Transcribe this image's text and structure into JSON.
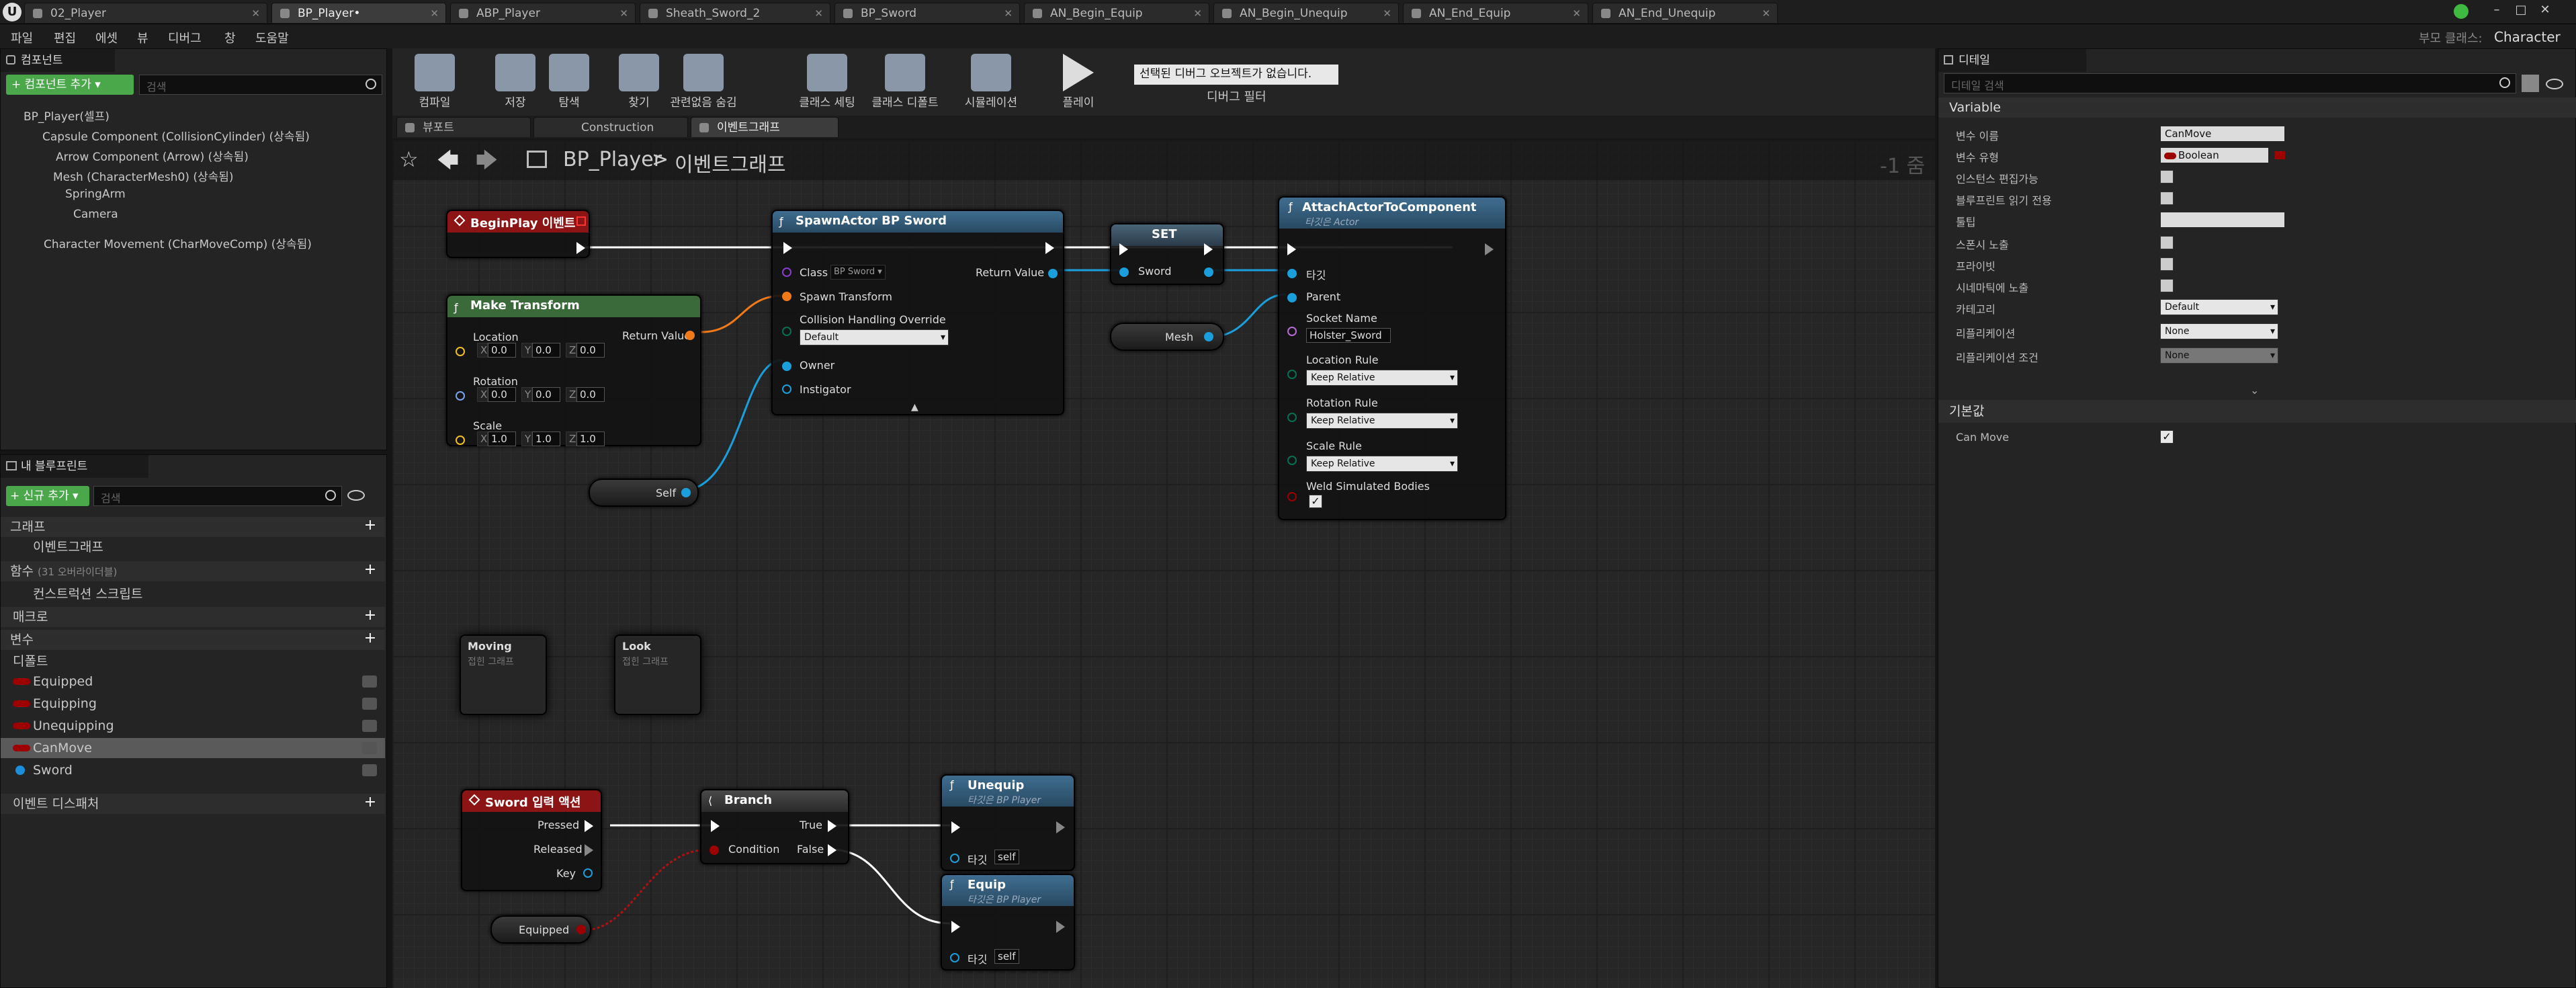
{
  "tabs": [
    {
      "label": "02_Player",
      "icon": "level-icon",
      "active": false
    },
    {
      "label": "BP_Player•",
      "icon": "blueprint-icon",
      "active": true
    },
    {
      "label": "ABP_Player",
      "icon": "anim-blueprint-icon",
      "active": false
    },
    {
      "label": "Sheath_Sword_2",
      "icon": "montage-icon",
      "active": false
    },
    {
      "label": "BP_Sword",
      "icon": "blueprint-icon",
      "active": false
    },
    {
      "label": "AN_Begin_Equip",
      "icon": "blueprint-icon",
      "active": false
    },
    {
      "label": "AN_Begin_Unequip",
      "icon": "blueprint-icon",
      "active": false
    },
    {
      "label": "AN_End_Equip",
      "icon": "blueprint-icon",
      "active": false
    },
    {
      "label": "AN_End_Unequip",
      "icon": "blueprint-icon",
      "active": false
    }
  ],
  "window": {
    "parent_class": "부모 클래스:",
    "class_name": "Character"
  },
  "menu": [
    "파일",
    "편집",
    "에셋",
    "뷰",
    "디버그",
    "창",
    "도움말"
  ],
  "components_panel": {
    "title": "컴포넌트",
    "add_button": "+ 컴포넌트 추가 ▾",
    "search_placeholder": "검색",
    "root": "BP_Player(셀프)",
    "items": [
      "Capsule Component (CollisionCylinder) (상속됨)",
      "Arrow Component (Arrow) (상속됨)",
      "Mesh (CharacterMesh0) (상속됨)",
      "SpringArm",
      "Camera",
      "Character Movement (CharMoveComp) (상속됨)"
    ]
  },
  "toolbar": {
    "buttons": [
      "컴파일",
      "저장",
      "탐색",
      "찾기",
      "관련없음 숨김",
      "클래스 세팅",
      "클래스 디폴트",
      "시뮬레이션",
      "플레이"
    ],
    "debug_dropdown": "선택된 디버그 오브젝트가 없습니다.",
    "debug_filter": "디버그 필터"
  },
  "editor_tabs": [
    "뷰포트",
    "Construction Script",
    "이벤트그래프"
  ],
  "breadcrumb": {
    "root": "BP_Player",
    "current": "이벤트그래프",
    "zoom": "-1 줌"
  },
  "my_blueprint": {
    "title": "내 블루프린트",
    "add_button": "+ 신규 추가 ▾",
    "search_placeholder": "검색",
    "graph_section": "그래프",
    "event_graph": "이벤트그래프",
    "functions_section": "함수",
    "functions_overridable": "(31 오버라이더블)",
    "construction_script": "컨스트럭션 스크립트",
    "macros_section": "매크로",
    "variables_section": "변수",
    "default_category": "디폴트",
    "variables": [
      {
        "name": "Equipped",
        "color": "#9c0000"
      },
      {
        "name": "Equipping",
        "color": "#9c0000"
      },
      {
        "name": "Unequipping",
        "color": "#9c0000"
      },
      {
        "name": "CanMove",
        "color": "#9c0000",
        "selected": true
      },
      {
        "name": "Sword",
        "color": "#1b8fdc"
      }
    ],
    "dispatchers_section": "이벤트 디스패처"
  },
  "details": {
    "title": "디테일",
    "search_placeholder": "디테일 검색",
    "variable_section": "Variable",
    "rows": [
      {
        "label": "변수 이름",
        "value": "CanMove",
        "kind": "text"
      },
      {
        "label": "변수 유형",
        "value": "Boolean",
        "kind": "type"
      },
      {
        "label": "인스턴스 편집가능",
        "value": "",
        "kind": "check"
      },
      {
        "label": "블루프린트 읽기 전용",
        "value": "",
        "kind": "check"
      },
      {
        "label": "툴팁",
        "value": "",
        "kind": "text"
      },
      {
        "label": "스폰시 노출",
        "value": "",
        "kind": "check"
      },
      {
        "label": "프라이빗",
        "value": "",
        "kind": "check"
      },
      {
        "label": "시네마틱에 노출",
        "value": "",
        "kind": "check"
      },
      {
        "label": "카테고리",
        "value": "Default",
        "kind": "dropdown"
      },
      {
        "label": "리플리케이션",
        "value": "None",
        "kind": "dropdown"
      },
      {
        "label": "리플리케이션 조건",
        "value": "None",
        "kind": "dropdown"
      }
    ],
    "default_section": "기본값",
    "default_row": {
      "label": "Can Move",
      "value": "✓"
    }
  },
  "nodes": {
    "beginplay": {
      "title": "BeginPlay 이벤트"
    },
    "make_transform": {
      "title": "Make Transform",
      "return_value": "Return Value",
      "location": "Location",
      "rotation": "Rotation",
      "scale": "Scale",
      "x": "X",
      "y": "Y",
      "z": "Z",
      "loc": [
        "0.0",
        "0.0",
        "0.0"
      ],
      "rot": [
        "0.0",
        "0.0",
        "0.0"
      ],
      "scl": [
        "1.0",
        "1.0",
        "1.0"
      ]
    },
    "spawn": {
      "title": "SpawnActor BP Sword",
      "class": "Class",
      "class_value": "BP Sword ▾",
      "return_value": "Return Value",
      "spawn_transform": "Spawn Transform",
      "collision": "Collision Handling Override",
      "collision_value": "Default",
      "owner": "Owner",
      "instigator": "Instigator"
    },
    "set": {
      "title": "SET",
      "sword": "Sword"
    },
    "attach": {
      "title": "AttachActorToComponent",
      "subtitle": "타깃은 Actor",
      "target": "타깃",
      "parent": "Parent",
      "socket_name": "Socket Name",
      "socket_value": "Holster_Sword",
      "location_rule": "Location Rule",
      "rotation_rule": "Rotation Rule",
      "scale_rule": "Scale Rule",
      "rule_value": "Keep Relative",
      "weld": "Weld Simulated Bodies"
    },
    "self": {
      "label": "Self"
    },
    "mesh": {
      "label": "Mesh"
    },
    "moving": {
      "title": "Moving",
      "subtitle": "접힌 그래프"
    },
    "look": {
      "title": "Look",
      "subtitle": "접힌 그래프"
    },
    "sword_input": {
      "title": "Sword 입력 액션",
      "pressed": "Pressed",
      "released": "Released",
      "key": "Key"
    },
    "branch": {
      "title": "Branch",
      "condition": "Condition",
      "true": "True",
      "false": "False"
    },
    "equipped": {
      "label": "Equipped"
    },
    "unequip": {
      "title": "Unequip",
      "subtitle": "타깃은 BP Player",
      "target": "타깃",
      "self": "self"
    },
    "equip": {
      "title": "Equip",
      "subtitle": "타깃은 BP Player",
      "target": "타깃",
      "self": "self"
    }
  }
}
